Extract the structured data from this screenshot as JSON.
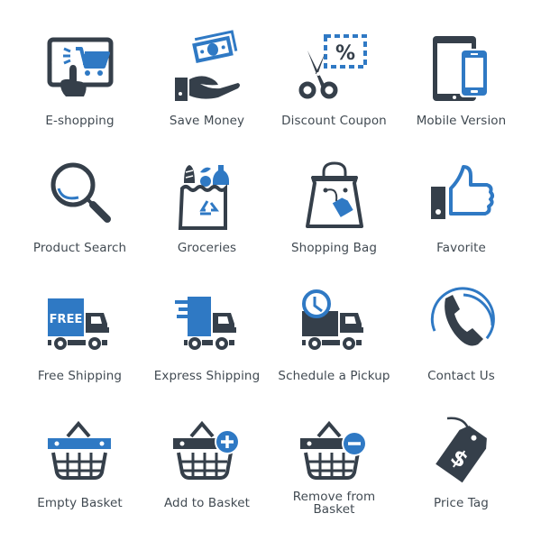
{
  "colors": {
    "dark": "#353f4a",
    "blue": "#2f79c4",
    "text": "#414a52"
  },
  "icons": [
    {
      "label": "E-shopping",
      "icon": "tablet-cart-icon"
    },
    {
      "label": "Save Money",
      "icon": "hand-money-icon"
    },
    {
      "label": "Discount Coupon",
      "icon": "scissors-coupon-icon"
    },
    {
      "label": "Mobile Version",
      "icon": "tablet-phone-icon"
    },
    {
      "label": "Product Search",
      "icon": "magnifier-icon"
    },
    {
      "label": "Groceries",
      "icon": "grocery-bag-icon"
    },
    {
      "label": "Shopping Bag",
      "icon": "shopping-bag-icon"
    },
    {
      "label": "Favorite",
      "icon": "thumbs-up-icon"
    },
    {
      "label": "Free Shipping",
      "icon": "free-truck-icon",
      "badge": "FREE"
    },
    {
      "label": "Express Shipping",
      "icon": "express-truck-icon"
    },
    {
      "label": "Schedule a Pickup",
      "icon": "clock-truck-icon"
    },
    {
      "label": "Contact Us",
      "icon": "phone-icon"
    },
    {
      "label": "Empty Basket",
      "icon": "basket-icon"
    },
    {
      "label": "Add to Basket",
      "icon": "basket-plus-icon"
    },
    {
      "label": "Remove from Basket",
      "label_lines": [
        "Remove from",
        "Basket"
      ],
      "icon": "basket-minus-icon"
    },
    {
      "label": "Price Tag",
      "icon": "price-tag-icon",
      "symbol": "$"
    }
  ]
}
